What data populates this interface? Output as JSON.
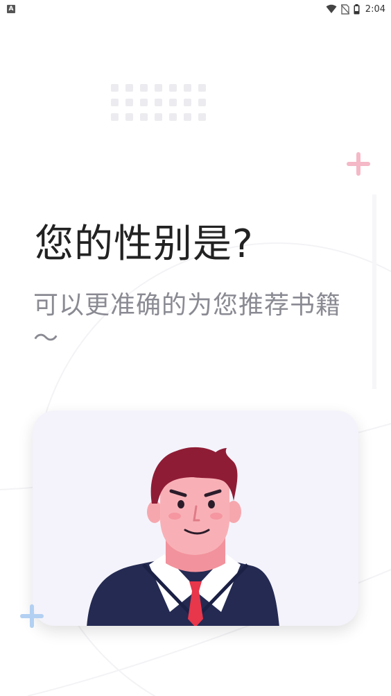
{
  "status_bar": {
    "notification_icon": "a-icon",
    "time": "2:04",
    "icons": [
      "wifi-icon",
      "no-sim-icon",
      "battery-icon"
    ]
  },
  "page": {
    "title": "您的性别是?",
    "subtitle": "可以更准确的为您推荐书籍～"
  },
  "gender_option": {
    "illustration": "male-avatar-illustration"
  },
  "colors": {
    "title": "#222222",
    "subtitle": "#8a8a93",
    "card_bg": "#f4f3fb",
    "accent_pink": "#f4b8c6",
    "accent_blue": "#b3d0f2"
  }
}
